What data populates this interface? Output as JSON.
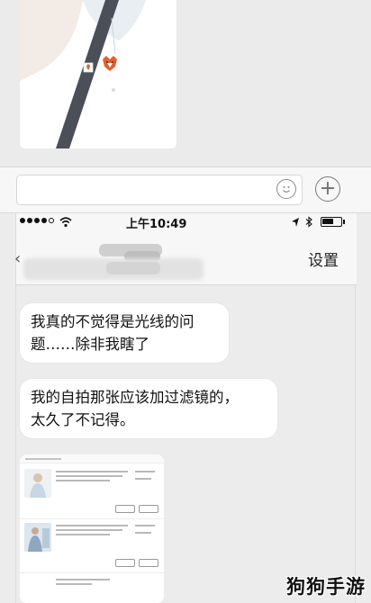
{
  "status_bar": {
    "time": "上午10:49",
    "wifi_icon": "wifi-icon",
    "location_icon": "location-arrow-icon",
    "bluetooth_icon": "bluetooth-icon",
    "battery_level": 0.65
  },
  "nav": {
    "settings_label": "设置"
  },
  "messages": [
    {
      "text_line1": "我真的不觉得是光线的问",
      "text_line2": "题……除非我瞎了"
    },
    {
      "text_line1": "我的自拍那张应该加过滤镜的，",
      "text_line2": "太久了不记得。"
    }
  ],
  "input_bar": {
    "emoji_icon": "emoji-icon",
    "plus_icon": "plus-circle-icon",
    "plus_symbol": "+"
  },
  "watermark": "狗狗手游"
}
